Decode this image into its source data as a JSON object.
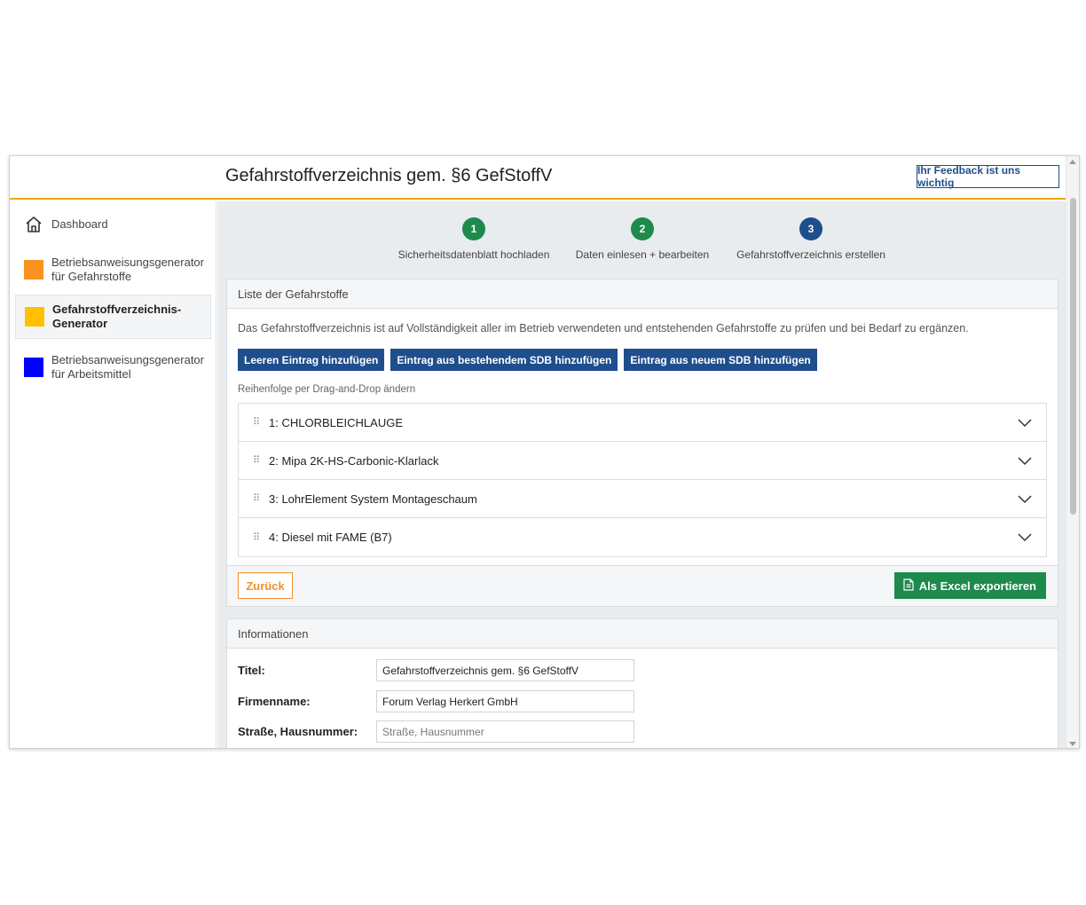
{
  "header": {
    "title": "Gefahrstoffverzeichnis gem. §6 GefStoffV",
    "feedback_label": "Ihr Feedback ist uns wichtig"
  },
  "sidebar": {
    "items": [
      {
        "label": "Dashboard",
        "icon": "home-icon"
      },
      {
        "label": "Betriebsanweisungsgenerator für Gefahrstoffe",
        "color": "#f7931e"
      },
      {
        "label": "Gefahrstoffverzeichnis-Generator",
        "color": "#ffc000",
        "active": true
      },
      {
        "label": "Betriebsanweisungsgenerator für Arbeitsmittel",
        "color": "#0000ff"
      }
    ]
  },
  "stepper": {
    "steps": [
      {
        "number": "1",
        "label": "Sicherheitsdatenblatt hochladen",
        "color": "#1e8a4c"
      },
      {
        "number": "2",
        "label": "Daten einlesen + bearbeiten",
        "color": "#1e8a4c"
      },
      {
        "number": "3",
        "label": "Gefahrstoffverzeichnis erstellen",
        "color": "#1f4e8c"
      }
    ]
  },
  "list_card": {
    "title": "Liste der Gefahrstoffe",
    "intro": "Das Gefahrstoffverzeichnis ist auf Vollständigkeit aller im Betrieb verwendeten und entstehenden Gefahrstoffe zu prüfen und bei Bedarf zu ergänzen.",
    "buttons": {
      "empty": "Leeren Eintrag hinzufügen",
      "existing": "Eintrag aus bestehendem SDB hinzufügen",
      "new": "Eintrag aus neuem SDB hinzufügen"
    },
    "dnd_hint": "Reihenfolge per Drag-and-Drop ändern",
    "items": [
      "1: CHLORBLEICHLAUGE",
      "2: Mipa 2K-HS-Carbonic-Klarlack",
      "3: LohrElement System Montageschaum",
      "4: Diesel mit FAME (B7)"
    ],
    "back_label": "Zurück",
    "export_label": "Als Excel exportieren"
  },
  "info_card": {
    "title": "Informationen",
    "fields": [
      {
        "label": "Titel:",
        "value": "Gefahrstoffverzeichnis gem. §6 GefStoffV",
        "placeholder": ""
      },
      {
        "label": "Firmenname:",
        "value": "Forum Verlag Herkert GmbH",
        "placeholder": ""
      },
      {
        "label": "Straße, Hausnummer:",
        "value": "",
        "placeholder": "Straße, Hausnummer"
      }
    ]
  },
  "colors": {
    "accent_blue": "#1f4e8c",
    "accent_green": "#1e8a4c",
    "accent_orange": "#f0902c",
    "header_line": "#f0a800"
  }
}
